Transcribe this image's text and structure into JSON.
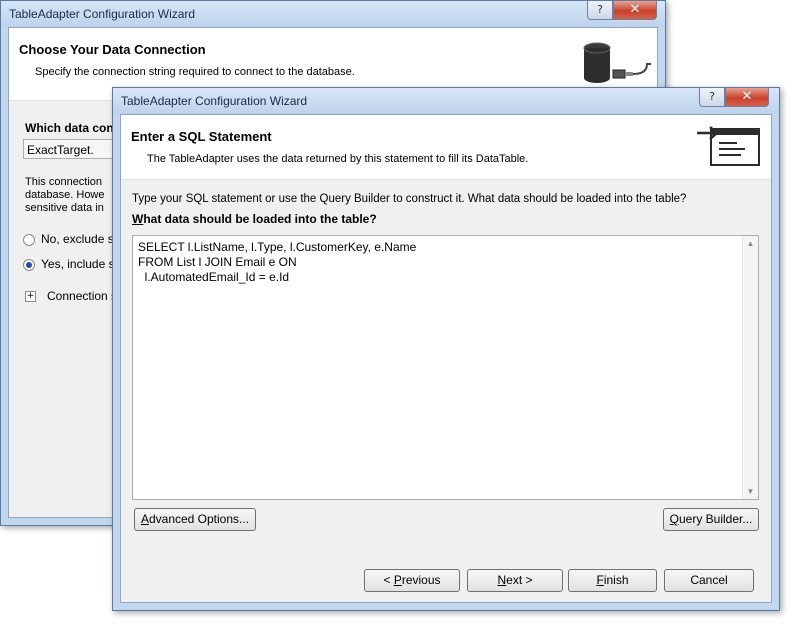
{
  "back_window": {
    "title": "TableAdapter Configuration Wizard",
    "help_glyph": "?",
    "close_glyph": "✕",
    "header_title": "Choose Your Data Connection",
    "header_desc": "Specify the connection string required to connect to the database.",
    "which_connection_label": "Which data con",
    "connection_value": "ExactTarget.",
    "info_line1": "This connection",
    "info_line2": "database. Howe",
    "info_line3": "sensitive data in",
    "radio_no_label": "No, exclude s",
    "radio_yes_label": "Yes, include s",
    "connection_expander_label": "Connection s"
  },
  "front_window": {
    "title": "TableAdapter Configuration Wizard",
    "help_glyph": "?",
    "close_glyph": "✕",
    "header_title": "Enter a SQL Statement",
    "header_desc": "The TableAdapter uses the data returned by this statement to fill its DataTable.",
    "instruction": "Type your SQL statement or use the Query Builder to construct it. What data should be loaded into the table?",
    "sql_label_prefix": "W",
    "sql_label_rest": "hat data should be loaded into the table?",
    "sql_text": "SELECT l.ListName, l.Type, l.CustomerKey, e.Name\nFROM List l JOIN Email e ON\n  l.AutomatedEmail_Id = e.Id",
    "advanced_options_prefix": "A",
    "advanced_options_rest": "dvanced Options...",
    "query_builder_prefix": "Q",
    "query_builder_rest": "uery Builder...",
    "previous_lead": "< ",
    "previous_prefix": "P",
    "previous_rest": "revious",
    "next_prefix": "N",
    "next_rest": "ext >",
    "finish_prefix": "F",
    "finish_rest": "inish",
    "cancel_label": "Cancel"
  }
}
